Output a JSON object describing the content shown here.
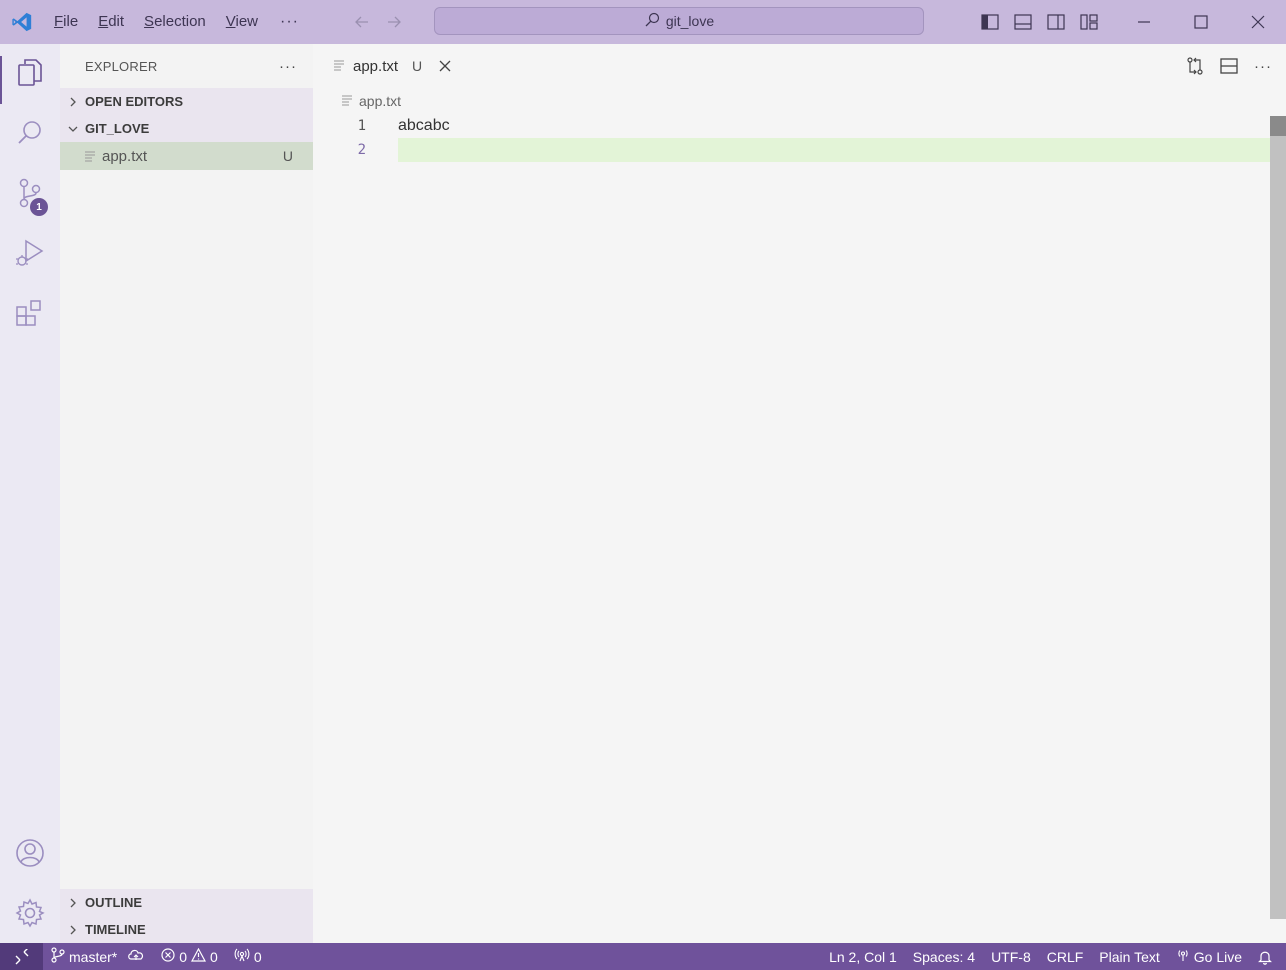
{
  "title_bar": {
    "menu": [
      {
        "label": "File",
        "accel": "F",
        "rest": "ile"
      },
      {
        "label": "Edit",
        "accel": "E",
        "rest": "dit"
      },
      {
        "label": "Selection",
        "accel": "S",
        "rest": "election"
      },
      {
        "label": "View",
        "accel": "V",
        "rest": "iew"
      }
    ],
    "more": "···",
    "search_text": "git_love"
  },
  "activity_bar": {
    "items": [
      "explorer-icon",
      "search-icon",
      "source-control-icon",
      "run-debug-icon",
      "extensions-icon"
    ],
    "source_control_badge": "1",
    "bottom": [
      "account-icon",
      "settings-gear-icon"
    ],
    "accent": "#6b5496"
  },
  "sidebar": {
    "title": "EXPLORER",
    "more": "···",
    "sections": {
      "open_editors": "OPEN EDITORS",
      "workspace": "GIT_LOVE",
      "outline": "OUTLINE",
      "timeline": "TIMELINE"
    },
    "files": [
      {
        "name": "app.txt",
        "status": "U"
      }
    ]
  },
  "editor": {
    "tab": {
      "name": "app.txt",
      "status": "U"
    },
    "more": "···",
    "breadcrumb": "app.txt",
    "lines": [
      {
        "number": "1",
        "text": "abcabc"
      },
      {
        "number": "2",
        "text": ""
      }
    ]
  },
  "status_bar": {
    "branch": "master*",
    "errors": "0",
    "warnings": "0",
    "ports": "0",
    "cursor": "Ln 2, Col 1",
    "spaces": "Spaces: 4",
    "encoding": "UTF-8",
    "eol": "CRLF",
    "language": "Plain Text",
    "go_live": "Go Live",
    "color": "#6f529b"
  }
}
